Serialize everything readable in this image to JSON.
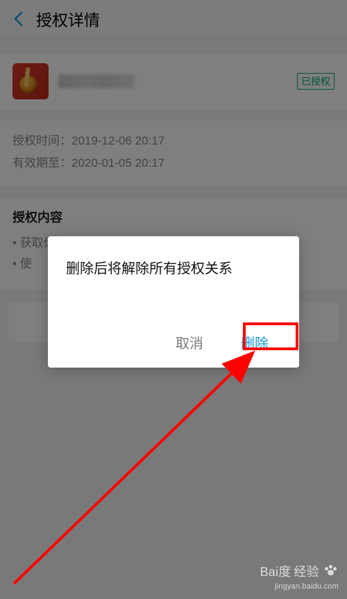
{
  "header": {
    "title": "授权详情"
  },
  "app": {
    "badge": "已授权"
  },
  "meta": {
    "auth_time_label": "授权时间：",
    "auth_time_value": "2019-12-06 20:17",
    "expire_label": "有效期至：",
    "expire_value": "2020-01-05 20:17"
  },
  "content": {
    "title": "授权内容",
    "items": [
      "获取你的公开信息(昵称、头像、性别等)",
      "使"
    ]
  },
  "modal": {
    "message": "删除后将解除所有授权关系",
    "cancel": "取消",
    "delete": "删除"
  },
  "watermark": {
    "brand": "Bai",
    "brand2": "度",
    "product": "经验",
    "url": "jingyan.baidu.com"
  }
}
